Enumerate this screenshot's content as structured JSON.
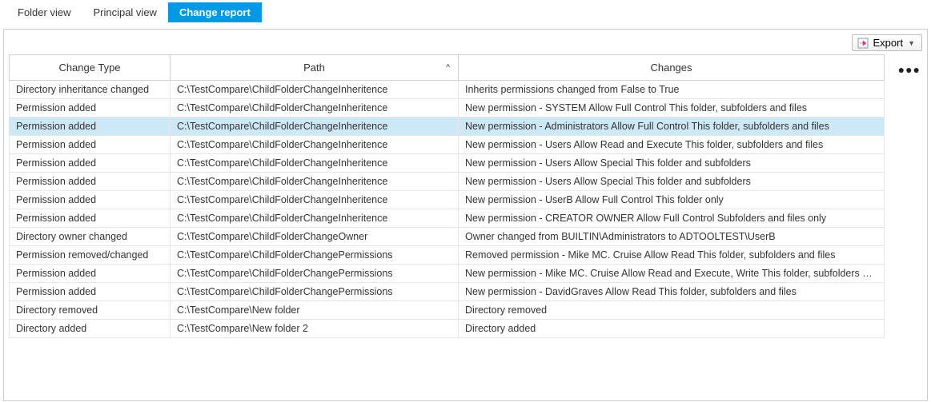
{
  "tabs": {
    "folder_view": "Folder view",
    "principal_view": "Principal view",
    "change_report": "Change report"
  },
  "toolbar": {
    "export_label": "Export"
  },
  "columns": {
    "change_type": "Change Type",
    "path": "Path",
    "changes": "Changes"
  },
  "sort_indicator": "^",
  "dots": "●●●",
  "rows": [
    {
      "selected": false,
      "change_type": "Directory inheritance changed",
      "path": "C:\\TestCompare\\ChildFolderChangeInheritence",
      "changes": "Inherits permissions changed from False to True"
    },
    {
      "selected": false,
      "change_type": "Permission added",
      "path": "C:\\TestCompare\\ChildFolderChangeInheritence",
      "changes": "New permission - SYSTEM Allow Full Control This folder, subfolders and files"
    },
    {
      "selected": true,
      "change_type": "Permission added",
      "path": "C:\\TestCompare\\ChildFolderChangeInheritence",
      "changes": "New permission - Administrators Allow Full Control This folder, subfolders and files"
    },
    {
      "selected": false,
      "change_type": "Permission added",
      "path": "C:\\TestCompare\\ChildFolderChangeInheritence",
      "changes": "New permission - Users Allow Read and Execute This folder, subfolders and files"
    },
    {
      "selected": false,
      "change_type": "Permission added",
      "path": "C:\\TestCompare\\ChildFolderChangeInheritence",
      "changes": "New permission - Users Allow Special This folder and subfolders"
    },
    {
      "selected": false,
      "change_type": "Permission added",
      "path": "C:\\TestCompare\\ChildFolderChangeInheritence",
      "changes": "New permission - Users Allow Special This folder and subfolders"
    },
    {
      "selected": false,
      "change_type": "Permission added",
      "path": "C:\\TestCompare\\ChildFolderChangeInheritence",
      "changes": "New permission - UserB Allow Full Control This folder only"
    },
    {
      "selected": false,
      "change_type": "Permission added",
      "path": "C:\\TestCompare\\ChildFolderChangeInheritence",
      "changes": "New permission - CREATOR OWNER Allow Full Control Subfolders and files only"
    },
    {
      "selected": false,
      "change_type": "Directory owner changed",
      "path": "C:\\TestCompare\\ChildFolderChangeOwner",
      "changes": "Owner changed from BUILTIN\\Administrators to ADTOOLTEST\\UserB"
    },
    {
      "selected": false,
      "change_type": "Permission removed/changed",
      "path": "C:\\TestCompare\\ChildFolderChangePermissions",
      "changes": "Removed permission - Mike MC. Cruise Allow Read This folder, subfolders and files"
    },
    {
      "selected": false,
      "change_type": "Permission added",
      "path": "C:\\TestCompare\\ChildFolderChangePermissions",
      "changes": "New permission - Mike MC. Cruise Allow Read and Execute, Write This folder, subfolders and files"
    },
    {
      "selected": false,
      "change_type": "Permission added",
      "path": "C:\\TestCompare\\ChildFolderChangePermissions",
      "changes": "New permission - DavidGraves Allow Read This folder, subfolders and files"
    },
    {
      "selected": false,
      "change_type": "Directory removed",
      "path": "C:\\TestCompare\\New folder",
      "changes": "Directory removed"
    },
    {
      "selected": false,
      "change_type": "Directory added",
      "path": "C:\\TestCompare\\New folder 2",
      "changes": "Directory added"
    }
  ]
}
